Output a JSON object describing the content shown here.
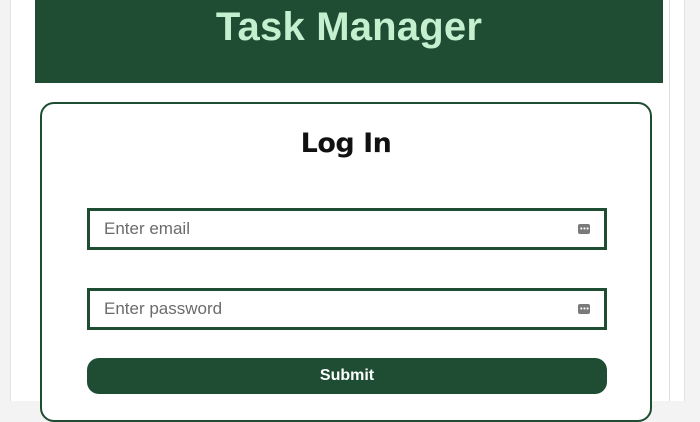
{
  "header": {
    "title": "Task Manager"
  },
  "login": {
    "title": "Log In",
    "email": {
      "value": "",
      "placeholder": "Enter email",
      "icon": "autofill-key-icon"
    },
    "password": {
      "value": "",
      "placeholder": "Enter password",
      "icon": "autofill-key-icon"
    },
    "submit_label": "Submit"
  },
  "colors": {
    "brand": "#1f4d33",
    "header_text": "#c4f0cf",
    "page_background": "#ffffff"
  }
}
